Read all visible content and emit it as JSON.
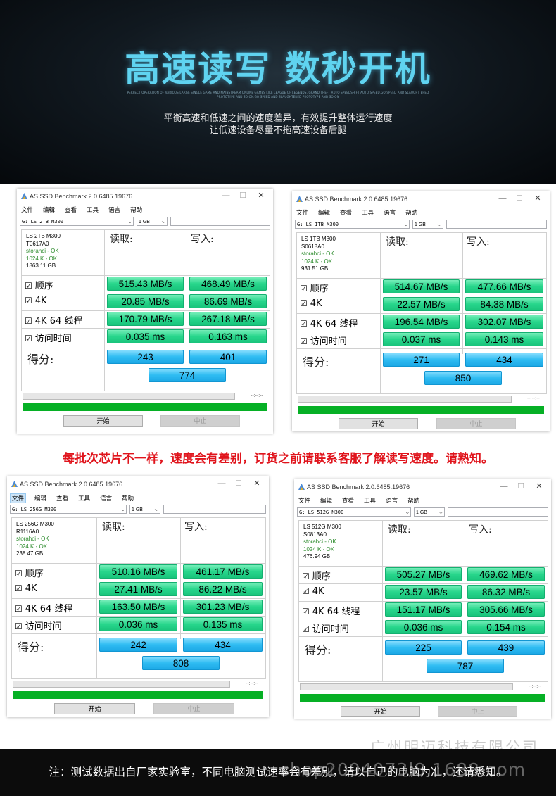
{
  "banner": {
    "title": "高速读写 数秒开机",
    "fine_print": "PERFECT OPERATION OF VARIOUS LARGE SINGLE GAME AND MAINSTREAM ONLINE GAMES LIKE LEAGUE OF LEGENDS, GRAND THEFT AUTO SPEEDSHIFT AUTO SPEED.GO SPEED AND SLAUGHT ERED PROTOTYPE AND SO ON.GO SPEED AND SLAUGHTERED PROTOTYPE AND SO ON",
    "line1": "平衡高速和低速之间的速度差异，有效提升整体运行速度",
    "line2": "让低速设备尽量不拖高速设备后腿"
  },
  "notice": "每批次芯片不一样，速度会有差别，订货之前请联系客服了解读写速度。请熟知。",
  "common": {
    "menu": [
      "文件",
      "编辑",
      "查看",
      "工具",
      "语言",
      "帮助"
    ],
    "size": "1 GB",
    "read_header": "读取:",
    "write_header": "写入:",
    "rows": [
      "顺序",
      "4K",
      "4K 64 线程",
      "访问时间"
    ],
    "score_label": "得分:",
    "timer": "--:--:--",
    "start_label": "开始",
    "stop_label": "中止",
    "minimize": "—",
    "maximize": "☐",
    "close": "✕"
  },
  "windows": [
    {
      "title": "AS SSD Benchmark 2.0.6485.19676",
      "drive": "G: LS 2TB M300",
      "info": [
        "LS 2TB M300",
        "T0617A0",
        "storahci - OK",
        "1024 K - OK",
        "1863.11 GB"
      ],
      "read": [
        "515.43 MB/s",
        "20.85 MB/s",
        "170.79 MB/s",
        "0.035 ms"
      ],
      "write": [
        "468.49 MB/s",
        "86.69 MB/s",
        "267.18 MB/s",
        "0.163 ms"
      ],
      "score_read": "243",
      "score_write": "401",
      "score_total": "774"
    },
    {
      "title": "AS SSD Benchmark 2.0.6485.19676",
      "drive": "G: LS 1TB M300",
      "info": [
        "LS 1TB M300",
        "S0618A0",
        "storahci - OK",
        "1024 K - OK",
        "931.51 GB"
      ],
      "read": [
        "514.67 MB/s",
        "22.57 MB/s",
        "196.54 MB/s",
        "0.037 ms"
      ],
      "write": [
        "477.66 MB/s",
        "84.38 MB/s",
        "302.07 MB/s",
        "0.143 ms"
      ],
      "score_read": "271",
      "score_write": "434",
      "score_total": "850"
    },
    {
      "title": "AS SSD Benchmark 2.0.6485.19676",
      "drive": "G: LS 256G M300",
      "info": [
        "LS 256G M300",
        "R1116A0",
        "storahci - OK",
        "1024 K - OK",
        "238.47 GB"
      ],
      "read": [
        "510.16 MB/s",
        "27.41 MB/s",
        "163.50 MB/s",
        "0.036 ms"
      ],
      "write": [
        "461.17 MB/s",
        "86.22 MB/s",
        "301.23 MB/s",
        "0.135 ms"
      ],
      "score_read": "242",
      "score_write": "434",
      "score_total": "808"
    },
    {
      "title": "AS SSD Benchmark 2.0.6485.19676",
      "drive": "G: LS 512G M300",
      "info": [
        "LS 512G M300",
        "S0813A0",
        "storahci - OK",
        "1024 K - OK",
        "476.94 GB"
      ],
      "read": [
        "505.27 MB/s",
        "23.57 MB/s",
        "151.17 MB/s",
        "0.036 ms"
      ],
      "write": [
        "469.62 MB/s",
        "86.32 MB/s",
        "305.66 MB/s",
        "0.154 ms"
      ],
      "score_read": "225",
      "score_write": "439",
      "score_total": "787"
    }
  ],
  "company": "广州明迈科技有限公司",
  "footer_note": "注：测试数据出自厂家实验室，不同电脑测试速率会有差别，请以自己的电脑为准，还请悉知。",
  "watermark": "shop2094073l8.1688.com"
}
